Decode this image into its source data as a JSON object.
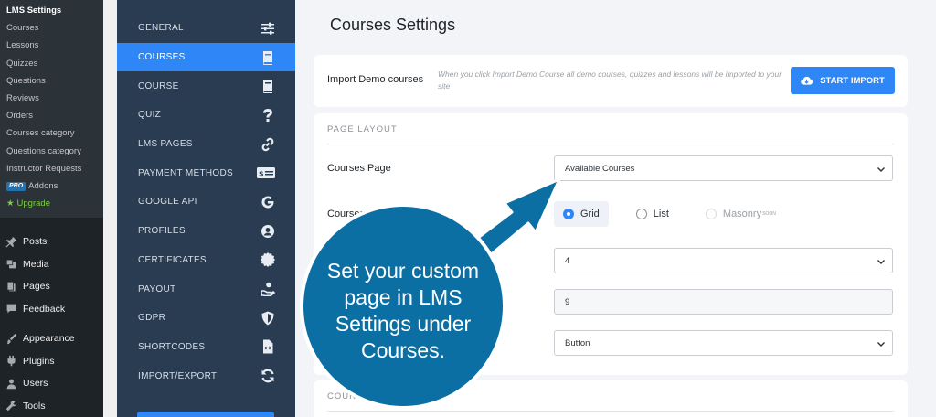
{
  "wp_menu": {
    "sub_items": [
      {
        "label": "LMS Settings",
        "current": true
      },
      {
        "label": "Courses"
      },
      {
        "label": "Lessons"
      },
      {
        "label": "Quizzes"
      },
      {
        "label": "Questions"
      },
      {
        "label": "Reviews"
      },
      {
        "label": "Orders"
      },
      {
        "label": "Courses category"
      },
      {
        "label": "Questions category"
      },
      {
        "label": "Instructor Requests"
      }
    ],
    "pro_badge": "PRO",
    "addons_label": "Addons",
    "upgrade_label": "Upgrade",
    "main_items": [
      {
        "label": "Posts",
        "icon": "pin-icon"
      },
      {
        "label": "Media",
        "icon": "media-icon"
      },
      {
        "label": "Pages",
        "icon": "pages-icon"
      },
      {
        "label": "Feedback",
        "icon": "feedback-icon"
      },
      {
        "label": "Appearance",
        "icon": "brush-icon"
      },
      {
        "label": "Plugins",
        "icon": "plugin-icon"
      },
      {
        "label": "Users",
        "icon": "user-icon"
      },
      {
        "label": "Tools",
        "icon": "wrench-icon"
      }
    ]
  },
  "settings_nav": {
    "items": [
      {
        "label": "GENERAL",
        "icon": "sliders-icon"
      },
      {
        "label": "COURSES",
        "icon": "book-icon",
        "active": true
      },
      {
        "label": "COURSE",
        "icon": "book-icon"
      },
      {
        "label": "QUIZ",
        "icon": "question-icon"
      },
      {
        "label": "LMS PAGES",
        "icon": "link-icon"
      },
      {
        "label": "PAYMENT METHODS",
        "icon": "credit-card-icon"
      },
      {
        "label": "GOOGLE API",
        "icon": "google-icon"
      },
      {
        "label": "PROFILES",
        "icon": "profile-icon"
      },
      {
        "label": "CERTIFICATES",
        "icon": "certificate-icon"
      },
      {
        "label": "PAYOUT",
        "icon": "payout-icon"
      },
      {
        "label": "GDPR",
        "icon": "shield-icon"
      },
      {
        "label": "SHORTCODES",
        "icon": "code-file-icon"
      },
      {
        "label": "IMPORT/EXPORT",
        "icon": "sync-icon"
      }
    ]
  },
  "main": {
    "title": "Courses Settings",
    "import": {
      "label": "Import Demo courses",
      "description": "When you click Import Demo Course all demo courses, quizzes and lessons will be imported to your site",
      "button": "START IMPORT"
    },
    "page_layout": {
      "section_title": "PAGE LAYOUT",
      "courses_page_label": "Courses Page",
      "courses_page_value": "Available Courses",
      "layout_label": "Courses Page Layout",
      "layout_options": [
        "Grid",
        "List",
        "Masonry"
      ],
      "layout_selected": "Grid",
      "soon_badge": "SOON",
      "per_row_value": "4",
      "per_page_value": "9",
      "load_more_value": "Button"
    },
    "next_section_title": "COURSE"
  },
  "callout": {
    "text": "Set your custom page in LMS Settings under Courses."
  },
  "colors": {
    "accent": "#2f86f6",
    "nav_bg": "#293c52",
    "wp_bg": "#1d2327",
    "callout": "#0b6fa4"
  }
}
